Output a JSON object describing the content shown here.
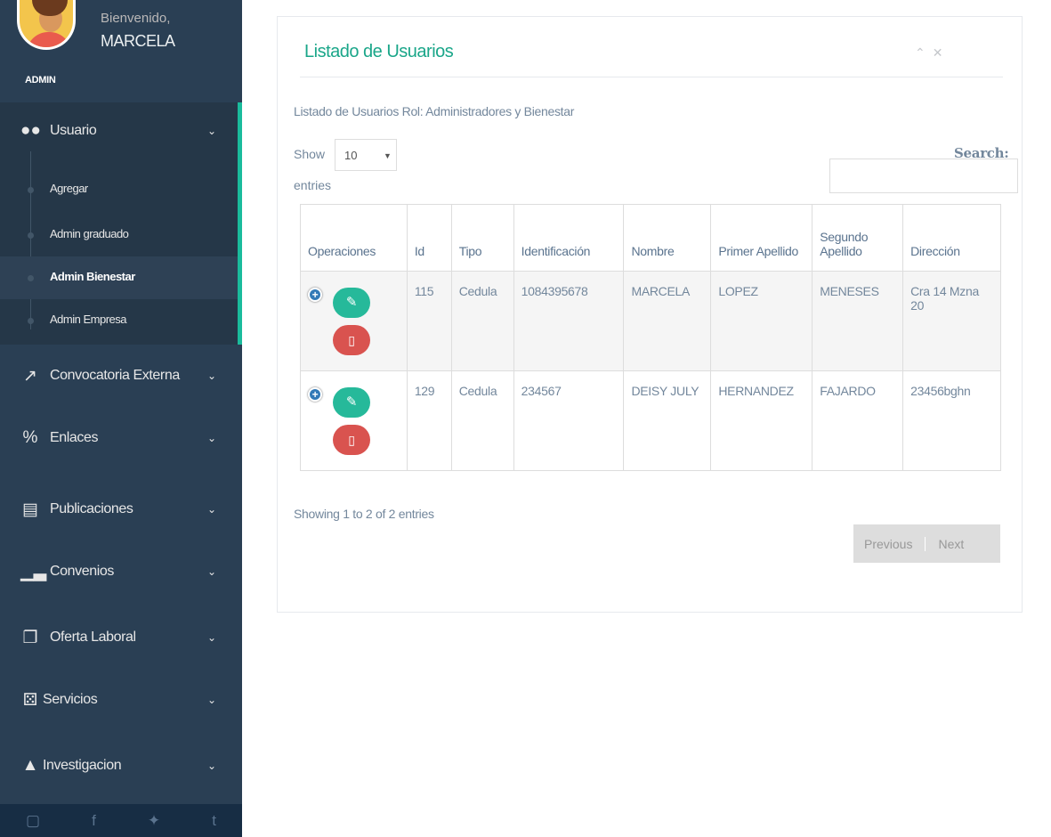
{
  "profile": {
    "welcome": "Bienvenido,",
    "name": "MARCELA",
    "role": "ADMIN"
  },
  "sidebar": {
    "usuario": {
      "icon": "users-icon",
      "label": "Usuario",
      "sub_items": [
        {
          "label": "Agregar"
        },
        {
          "label": "Admin graduado"
        },
        {
          "label": "Admin Bienestar",
          "active": true
        },
        {
          "label": "Admin Empresa"
        }
      ]
    },
    "items": [
      {
        "icon": "external-link-icon",
        "label": "Convocatoria Externa"
      },
      {
        "icon": "link-icon",
        "label": "Enlaces"
      },
      {
        "icon": "newspaper-icon",
        "label": "Publicaciones"
      },
      {
        "icon": "bar-chart-icon",
        "label": "Convenios"
      },
      {
        "icon": "copy-icon",
        "label": "Oferta Laboral"
      },
      {
        "icon": "cubes-icon",
        "label": "Servicios"
      },
      {
        "icon": "graduation-cap-icon",
        "label": "Investigacion"
      }
    ],
    "footer_icons": [
      "youtube-icon",
      "facebook-icon",
      "twitter-icon",
      "tumblr-icon"
    ]
  },
  "panel": {
    "title": "Listado de Usuarios",
    "subtitle": "Listado de Usuarios Rol: Administradores y Bienestar",
    "show_label": "Show",
    "entries_value": "10",
    "entries_label": "entries",
    "search_label": "Search:",
    "search_value": "",
    "columns": [
      "Operaciones",
      "Id",
      "Tipo",
      "Identificación",
      "Nombre",
      "Primer Apellido",
      "Segundo Apellido",
      "Dirección"
    ],
    "rows": [
      {
        "id": "115",
        "tipo": "Cedula",
        "identificacion": "1084395678",
        "nombre": "MARCELA",
        "primer_apellido": "LOPEZ",
        "segundo_apellido": "MENESES",
        "direccion": "Cra 14 Mzna 20"
      },
      {
        "id": "129",
        "tipo": "Cedula",
        "identificacion": "234567",
        "nombre": "DEISY JULY",
        "primer_apellido": "HERNANDEZ",
        "segundo_apellido": "FAJARDO",
        "direccion": "23456bghn"
      }
    ],
    "showing": "Showing 1 to 2 of 2 entries",
    "prev_label": "Previous",
    "next_label": "Next"
  },
  "colors": {
    "sidebar": "#2a3f54",
    "accent": "#1abb9c",
    "edit": "#26b99a",
    "delete": "#d9534f"
  }
}
